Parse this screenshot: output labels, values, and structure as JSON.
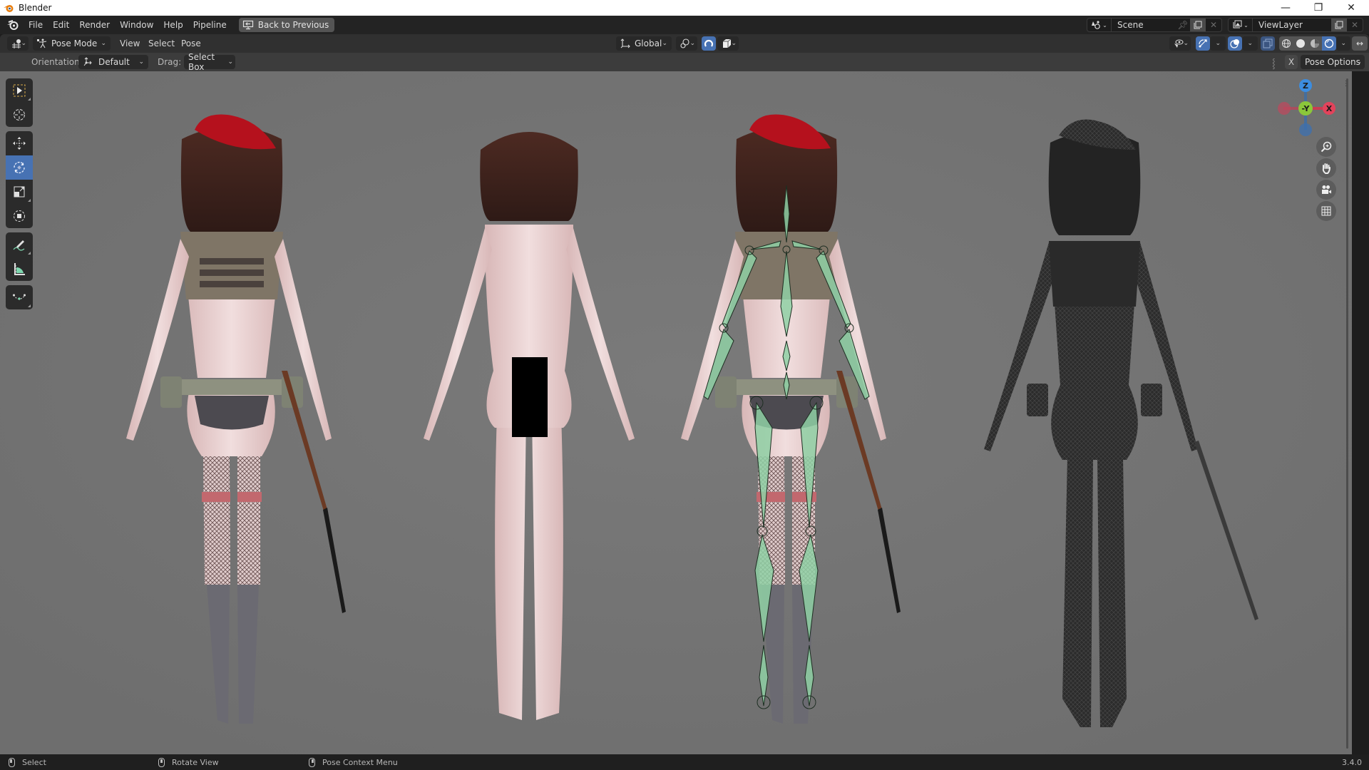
{
  "window": {
    "title": "Blender",
    "controls": {
      "minimize": "—",
      "maximize": "❐",
      "close": "✕"
    }
  },
  "topbar": {
    "menus": [
      "File",
      "Edit",
      "Render",
      "Window",
      "Help",
      "Pipeline"
    ],
    "back_button": "Back to Previous",
    "scene": {
      "value": "Scene"
    },
    "view_layer": {
      "value": "ViewLayer"
    }
  },
  "header": {
    "mode": "Pose Mode",
    "menus": [
      "View",
      "Select",
      "Pose"
    ],
    "transform_orientation": "Global",
    "shading_mode": "Material Preview",
    "overlays_enabled": true,
    "gizmos_enabled": true,
    "xray_enabled": false
  },
  "tool_settings": {
    "orientation_label": "Orientation:",
    "orientation_value": "Default",
    "drag_label": "Drag:",
    "drag_value": "Select Box",
    "x_mirror": "X",
    "options_label": "Pose Options"
  },
  "toolbar": {
    "groups": [
      [
        "select-box",
        "cursor"
      ],
      [
        "move",
        "rotate",
        "scale",
        "transform"
      ],
      [
        "annotate",
        "measure"
      ],
      [
        "bone-envelope"
      ]
    ],
    "active_tool": "rotate"
  },
  "navigation_gizmo": {
    "axes": {
      "z": "Z",
      "y": "-Y",
      "x": "X"
    },
    "colors": {
      "x": "#e2435b",
      "y": "#8bc73a",
      "z": "#3c8de0"
    },
    "buttons": [
      "zoom",
      "pan",
      "camera-view",
      "ortho-toggle"
    ]
  },
  "viewport": {
    "background": "#737373",
    "characters": [
      {
        "name": "clothed-model",
        "shading": "textured"
      },
      {
        "name": "base-body-model",
        "shading": "textured",
        "censored": true
      },
      {
        "name": "rigged-model",
        "shading": "textured",
        "armature_visible": true
      },
      {
        "name": "wireframe-model",
        "shading": "wireframe"
      }
    ]
  },
  "statusbar": {
    "left_click": "Select",
    "middle_click": "Rotate View",
    "right_click": "Pose Context Menu",
    "version": "3.4.0"
  },
  "colors": {
    "accent": "#4772b3",
    "bone_green": "#8fd0a4",
    "beret_red": "#b5111d"
  }
}
